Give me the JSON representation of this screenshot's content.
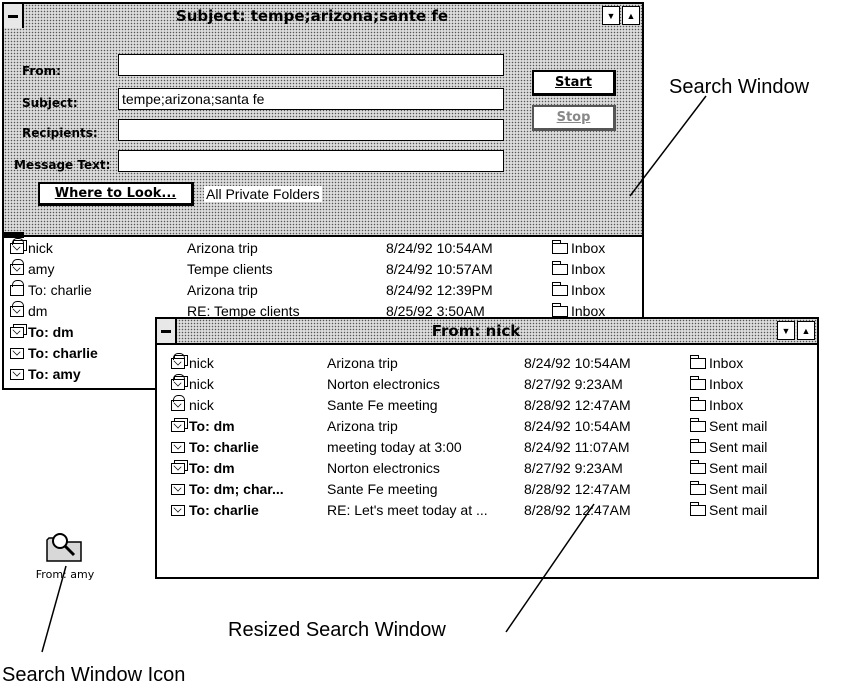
{
  "window1": {
    "title": "Subject: tempe;arizona;sante fe",
    "labels": {
      "from": "From:",
      "subject": "Subject:",
      "recipients": "Recipients:",
      "message_text": "Message Text:"
    },
    "values": {
      "from": "",
      "subject": "tempe;arizona;santa fe",
      "recipients": "",
      "message_text": ""
    },
    "start_label": "Start",
    "stop_label": "Stop",
    "where_button": "Where to Look...",
    "where_value": "All Private Folders",
    "rows": [
      {
        "icon": "open-envelope-double-icon",
        "who": "nick",
        "subject": "Arizona trip",
        "date": "8/24/92 10:54AM",
        "folder": "Inbox",
        "bold": false
      },
      {
        "icon": "open-envelope-icon",
        "who": "amy",
        "subject": "Tempe clients",
        "date": "8/24/92 10:57AM",
        "folder": "Inbox",
        "bold": false
      },
      {
        "icon": "sent-envelope-icon",
        "who": "To: charlie",
        "subject": "Arizona trip",
        "date": "8/24/92 12:39PM",
        "folder": "Inbox",
        "bold": false
      },
      {
        "icon": "open-envelope-icon",
        "who": "dm",
        "subject": "RE: Tempe clients",
        "date": "8/25/92 3:50AM",
        "folder": "Inbox",
        "bold": false
      },
      {
        "icon": "envelope-double-icon",
        "who": "To: dm",
        "subject": "",
        "date": "",
        "folder": "",
        "bold": true
      },
      {
        "icon": "envelope-icon",
        "who": "To: charlie",
        "subject": "",
        "date": "",
        "folder": "",
        "bold": true
      },
      {
        "icon": "envelope-icon",
        "who": "To: amy",
        "subject": "",
        "date": "",
        "folder": "",
        "bold": true
      }
    ]
  },
  "window2": {
    "title": "From: nick",
    "rows": [
      {
        "icon": "open-envelope-double-icon",
        "who": "nick",
        "subject": "Arizona trip",
        "date": "8/24/92 10:54AM",
        "folder": "Inbox",
        "bold": false
      },
      {
        "icon": "open-envelope-double-icon",
        "who": "nick",
        "subject": "Norton electronics",
        "date": "8/27/92 9:23AM",
        "folder": "Inbox",
        "bold": false
      },
      {
        "icon": "open-envelope-icon",
        "who": "nick",
        "subject": "Sante Fe meeting",
        "date": "8/28/92 12:47AM",
        "folder": "Inbox",
        "bold": false
      },
      {
        "icon": "envelope-double-icon",
        "who": "To: dm",
        "subject": "Arizona trip",
        "date": "8/24/92 10:54AM",
        "folder": "Sent mail",
        "bold": true
      },
      {
        "icon": "envelope-icon",
        "who": "To: charlie",
        "subject": "meeting today at 3:00",
        "date": "8/24/92 11:07AM",
        "folder": "Sent mail",
        "bold": true
      },
      {
        "icon": "envelope-double-icon",
        "who": "To: dm",
        "subject": "Norton electronics",
        "date": "8/27/92 9:23AM",
        "folder": "Sent mail",
        "bold": true
      },
      {
        "icon": "envelope-icon",
        "who": "To: dm; char...",
        "subject": "Sante Fe meeting",
        "date": "8/28/92 12:47AM",
        "folder": "Sent mail",
        "bold": true
      },
      {
        "icon": "envelope-icon",
        "who": "To: charlie",
        "subject": "RE: Let's meet today at ...",
        "date": "8/28/92 12:47AM",
        "folder": "Sent mail",
        "bold": true
      }
    ]
  },
  "desktop_icon": {
    "label": "From: amy",
    "icon": "search-folder-icon"
  },
  "annotations": {
    "search_window": "Search Window",
    "resized_search_window": "Resized Search Window",
    "search_window_icon": "Search Window Icon"
  }
}
